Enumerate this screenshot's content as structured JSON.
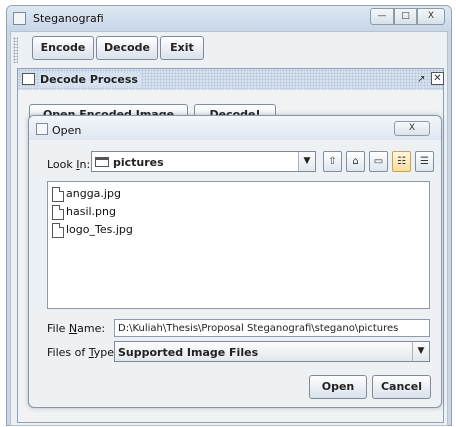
{
  "window": {
    "title": "Steganografi",
    "controls": {
      "minimize": "—",
      "maximize": "□",
      "close": "X"
    }
  },
  "toolbar": {
    "encode_label": "Encode",
    "decode_label": "Decode",
    "exit_label": "Exit"
  },
  "internal_frame": {
    "title": "Decode Process",
    "open_button_label": "Open Encoded Image",
    "decode_button_label": "Decode!"
  },
  "dialog": {
    "title": "Open",
    "close_label": "X",
    "look_in_label_pre": "Look ",
    "look_in_label_key": "I",
    "look_in_label_post": "n:",
    "look_in_value": "pictures",
    "files": [
      "angga.jpg",
      "hasil.png",
      "logo_Tes.jpg"
    ],
    "file_name_label_pre": "File ",
    "file_name_label_key": "N",
    "file_name_label_post": "ame:",
    "file_name_value": "D:\\Kuliah\\Thesis\\Proposal Steganografi\\stegano\\pictures",
    "files_of_type_label_pre": "Files of ",
    "files_of_type_label_key": "T",
    "files_of_type_label_post": "ype:",
    "files_of_type_value": "Supported Image Files",
    "open_label": "Open",
    "cancel_label": "Cancel"
  },
  "icons": {
    "app": "java-cup-icon",
    "dropdown": "triangle-down-icon",
    "up_folder": "up-folder-icon",
    "home": "home-icon",
    "new_folder": "new-folder-icon",
    "list_view": "list-view-icon",
    "details_view": "details-view-icon",
    "file": "file-icon"
  }
}
